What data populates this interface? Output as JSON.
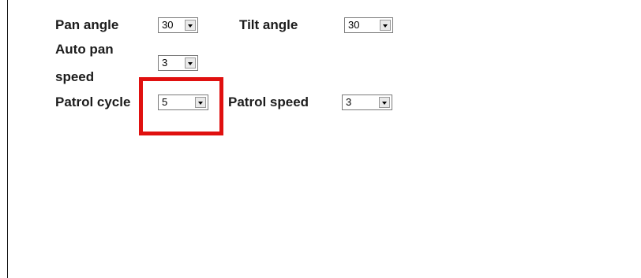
{
  "settings": {
    "pan_angle": {
      "label": "Pan angle",
      "value": "30"
    },
    "tilt_angle": {
      "label": "Tilt angle",
      "value": "30"
    },
    "auto_pan_speed": {
      "label_line1": "Auto pan",
      "label_line2": "speed",
      "value": "3"
    },
    "patrol_cycle": {
      "label": "Patrol cycle",
      "value": "5"
    },
    "patrol_speed": {
      "label": "Patrol speed",
      "value": "3"
    }
  },
  "colors": {
    "highlight": "#e0100f",
    "text": "#1c1c1c"
  },
  "icons": {
    "dropdown": "chevron-down-icon"
  }
}
